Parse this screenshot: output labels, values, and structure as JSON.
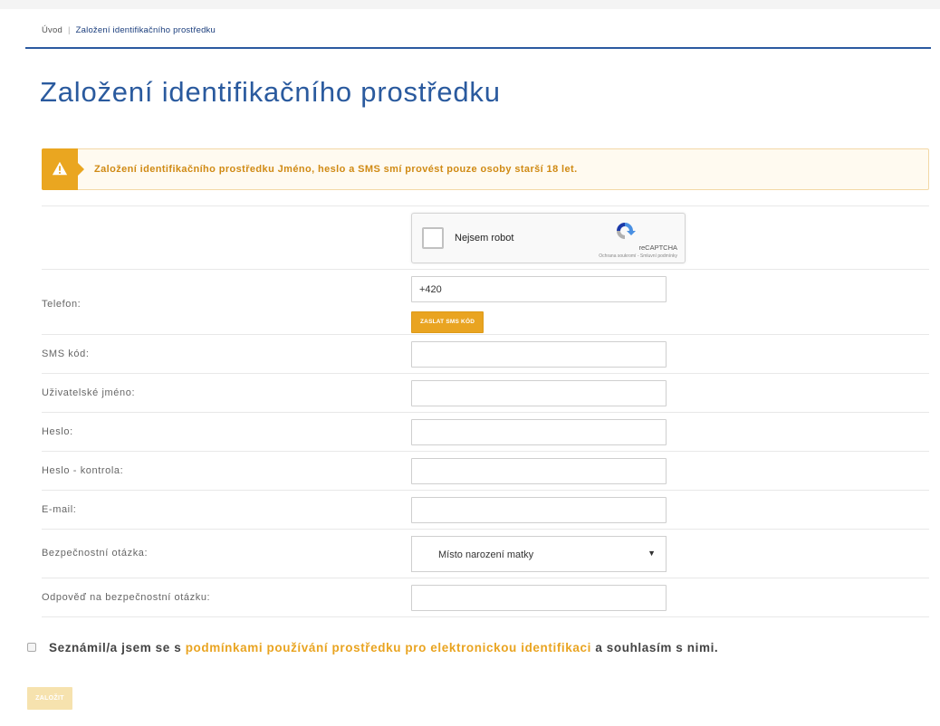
{
  "breadcrumb": {
    "home": "Úvod",
    "separator": "|",
    "current": "Založení identifikačního prostředku"
  },
  "page": {
    "title": "Založení identifikačního prostředku"
  },
  "alert": {
    "icon": "warning-icon",
    "text": "Založení identifikačního prostředku Jméno, heslo a SMS smí provést pouze osoby starší 18 let."
  },
  "captcha": {
    "label": "Nejsem robot",
    "brand": "reCAPTCHA",
    "links": "Ochrana soukromí - Smluvní podmínky"
  },
  "form": {
    "phone": {
      "label": "Telefon:",
      "value": "+420",
      "button": "ZASLAT SMS KÓD"
    },
    "sms_code": {
      "label": "SMS kód:",
      "value": ""
    },
    "username": {
      "label": "Uživatelské jméno:",
      "value": ""
    },
    "password": {
      "label": "Heslo:",
      "value": ""
    },
    "password_confirm": {
      "label": "Heslo - kontrola:",
      "value": ""
    },
    "email": {
      "label": "E-mail:",
      "value": ""
    },
    "security_question": {
      "label": "Bezpečnostní otázka:",
      "selected": "Místo narození matky"
    },
    "security_answer": {
      "label": "Odpověď na bezpečnostní otázku:",
      "value": ""
    }
  },
  "consent": {
    "prefix": "Seznámil/a jsem se s",
    "link": "podmínkami používání prostředku pro elektronickou identifikaci",
    "suffix": "a souhlasím s nimi.",
    "checked": false
  },
  "submit": {
    "label": "ZALOŽIT"
  },
  "colors": {
    "accent": "#e9a421",
    "title_blue": "#2a5a9e",
    "breadcrumb_line": "#2b5aa0"
  }
}
